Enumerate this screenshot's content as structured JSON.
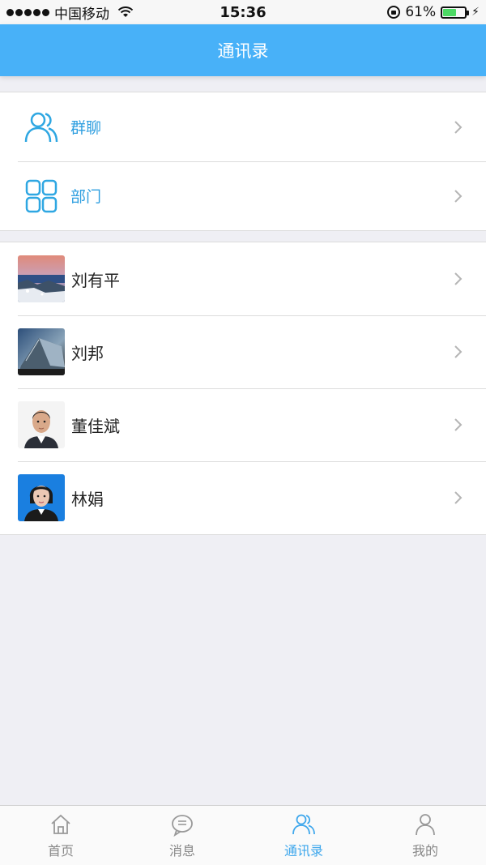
{
  "status_bar": {
    "carrier": "中国移动",
    "time": "15:36",
    "battery_percent": "61%",
    "battery_level": 0.61
  },
  "nav": {
    "title": "通讯录"
  },
  "groups": [
    {
      "label": "群聊",
      "icon": "group-chat-icon"
    },
    {
      "label": "部门",
      "icon": "department-grid-icon"
    }
  ],
  "contacts": [
    {
      "name": "刘有平",
      "avatar": "landscape-photo"
    },
    {
      "name": "刘邦",
      "avatar": "building-photo"
    },
    {
      "name": "董佳斌",
      "avatar": "portrait-photo-male"
    },
    {
      "name": "林娟",
      "avatar": "portrait-photo-female"
    }
  ],
  "tabs": [
    {
      "label": "首页",
      "icon": "home-icon",
      "active": false
    },
    {
      "label": "消息",
      "icon": "message-icon",
      "active": false
    },
    {
      "label": "通讯录",
      "icon": "contacts-icon",
      "active": true
    },
    {
      "label": "我的",
      "icon": "profile-icon",
      "active": false
    }
  ],
  "colors": {
    "accent": "#48b1f8",
    "accent_text": "#2f9fe0",
    "background": "#efeff4",
    "battery": "#4cd964"
  }
}
